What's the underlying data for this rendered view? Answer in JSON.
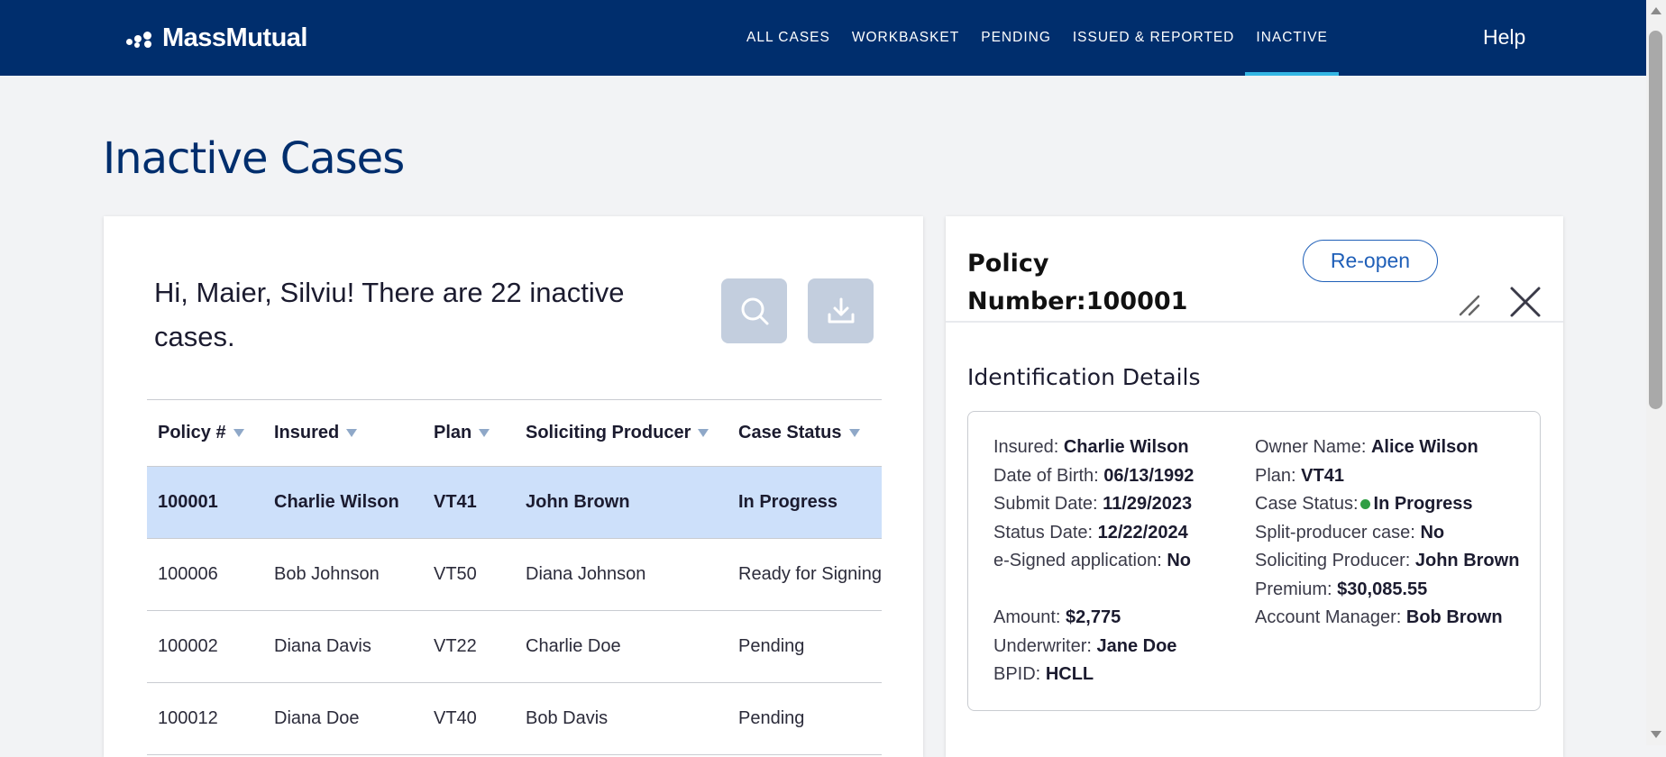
{
  "header": {
    "logo_text": "MassMutual",
    "nav": [
      {
        "label": "ALL CASES",
        "active": false
      },
      {
        "label": "WORKBASKET",
        "active": false
      },
      {
        "label": "PENDING",
        "active": false
      },
      {
        "label": "ISSUED & REPORTED",
        "active": false
      },
      {
        "label": "INACTIVE",
        "active": true
      }
    ],
    "help_label": "Help"
  },
  "page": {
    "title": "Inactive Cases"
  },
  "cases": {
    "greeting": "Hi, Maier, Silviu! There are 22 inactive cases.",
    "search_icon": "search-icon",
    "download_icon": "download-icon",
    "columns": [
      "Policy #",
      "Insured",
      "Plan",
      "Soliciting Producer",
      "Case Status"
    ],
    "rows": [
      {
        "policy": "100001",
        "insured": "Charlie Wilson",
        "plan": "VT41",
        "producer": "John Brown",
        "status": "In Progress",
        "selected": true
      },
      {
        "policy": "100006",
        "insured": "Bob Johnson",
        "plan": "VT50",
        "producer": "Diana Johnson",
        "status": "Ready for Signing",
        "selected": false
      },
      {
        "policy": "100002",
        "insured": "Diana Davis",
        "plan": "VT22",
        "producer": "Charlie Doe",
        "status": "Pending",
        "selected": false
      },
      {
        "policy": "100012",
        "insured": "Diana Doe",
        "plan": "VT40",
        "producer": "Bob Davis",
        "status": "Pending",
        "selected": false
      }
    ]
  },
  "detail": {
    "policy_label": "Policy",
    "policy_number_label": "Number:",
    "policy_number": "100001",
    "reopen_label": "Re-open",
    "section_title": "Identification Details",
    "left": [
      {
        "label": "Insured:",
        "value": "Charlie Wilson"
      },
      {
        "label": "Date of Birth:",
        "value": "06/13/1992"
      },
      {
        "label": "Submit Date:",
        "value": "11/29/2023"
      },
      {
        "label": "Status Date:",
        "value": "12/22/2024"
      },
      {
        "label": "e-Signed application:",
        "value": "No"
      },
      {
        "label": "Amount:",
        "value": "$2,775"
      },
      {
        "label": "Underwriter:",
        "value": "Jane Doe"
      },
      {
        "label": "BPID:",
        "value": "HCLL"
      }
    ],
    "right": [
      {
        "label": "Owner Name:",
        "value": "Alice Wilson"
      },
      {
        "label": "Plan:",
        "value": "VT41"
      },
      {
        "label": "Case Status:",
        "value": "In Progress"
      },
      {
        "label": "Split-producer case:",
        "value": "No"
      },
      {
        "label": "Soliciting Producer:",
        "value": "John Brown"
      },
      {
        "label": "Premium:",
        "value": "$30,085.55"
      },
      {
        "label": "Account Manager:",
        "value": "Bob Brown"
      }
    ],
    "status_color": "#2f9e44"
  },
  "colors": {
    "nav_bg": "#002e6d",
    "nav_active_underline": "#34b6e4",
    "selected_row": "#cde0fa",
    "accent": "#1f5fb8"
  }
}
